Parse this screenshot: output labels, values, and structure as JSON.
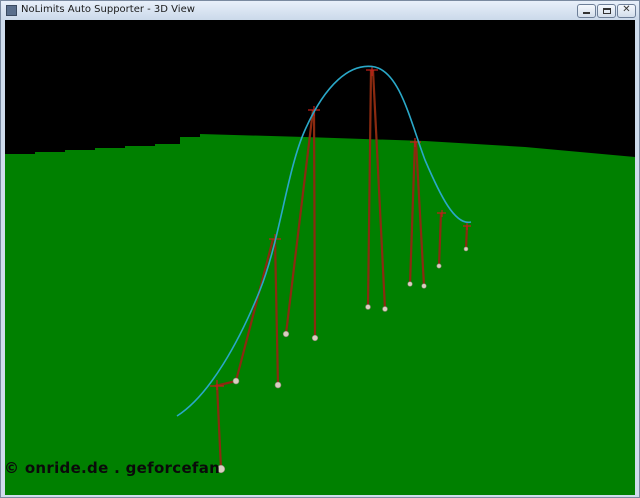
{
  "window": {
    "title": "NoLimits Auto Supporter - 3D View",
    "close_glyph": "✕",
    "icons": [
      "app-icon",
      "minimize-icon",
      "maximize-icon",
      "close-icon"
    ]
  },
  "scene": {
    "sky_color": "#000000",
    "ground_color": "#008000",
    "track_color": "#2aa8c8",
    "support_color": "#8b2a10",
    "footer_color": "#d8d0c0"
  },
  "watermark": "© onride.de . geforcefan"
}
